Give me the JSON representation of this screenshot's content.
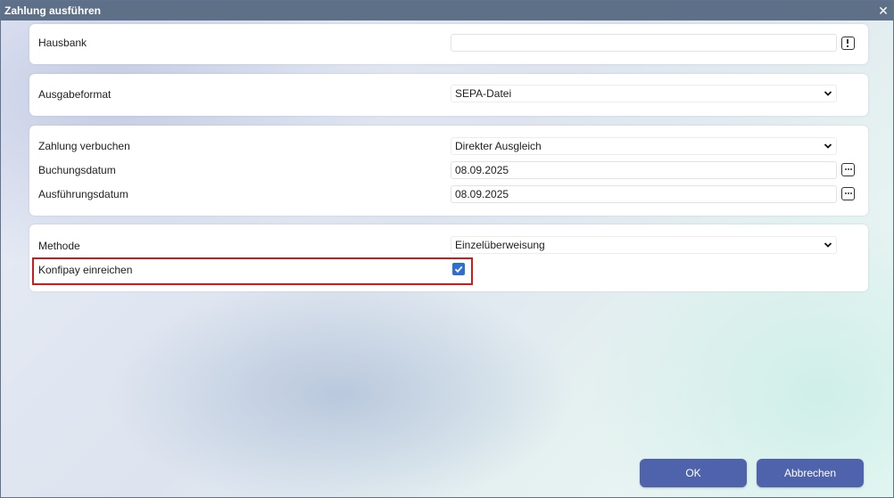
{
  "window": {
    "title": "Zahlung ausführen",
    "close_symbol": "✕"
  },
  "sections": {
    "bank": {
      "label": "Hausbank",
      "value": "",
      "icon": "exclamation-icon"
    },
    "format": {
      "label": "Ausgabeformat",
      "value": "SEPA-Datei"
    },
    "booking": {
      "posting_label": "Zahlung verbuchen",
      "posting_value": "Direkter Ausgleich",
      "booking_date_label": "Buchungsdatum",
      "booking_date_value": "08.09.2025",
      "execution_date_label": "Ausführungsdatum",
      "execution_date_value": "08.09.2025",
      "date_icon": "ellipsis-icon"
    },
    "method": {
      "label": "Methode",
      "value": "Einzelüberweisung",
      "konfipay_label": "Konfipay einreichen",
      "konfipay_checked": true
    }
  },
  "buttons": {
    "ok": "OK",
    "cancel": "Abbrechen"
  },
  "colors": {
    "titlebar": "#5e7088",
    "button": "#4f63ad",
    "checkbox": "#2f6fd4",
    "highlight": "#d11a1a"
  }
}
